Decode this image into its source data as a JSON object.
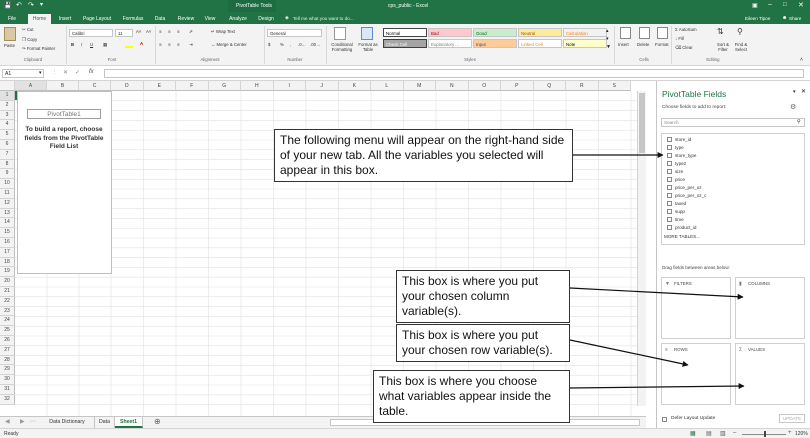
{
  "app": {
    "context_tab": "PivotTable Tools",
    "window_title": "cps_public - Excel",
    "user": "Eileen Tipoe",
    "share": "Share"
  },
  "tabs": [
    "File",
    "Home",
    "Insert",
    "Page Layout",
    "Formulas",
    "Data",
    "Review",
    "View",
    "Analyze",
    "Design"
  ],
  "active_tab": "Home",
  "tell_me": "Tell me what you want to do...",
  "ribbon": {
    "clipboard": {
      "paste": "Paste",
      "cut": "Cut",
      "copy": "Copy",
      "format_painter": "Format Painter",
      "label": "Clipboard"
    },
    "font": {
      "name": "Calibri",
      "size": "11",
      "label": "Font"
    },
    "alignment": {
      "wrap": "Wrap Text",
      "merge": "Merge & Center",
      "label": "Alignment"
    },
    "number": {
      "format": "General",
      "label": "Number"
    },
    "styles": {
      "conditional": "Conditional Formatting",
      "format_table": "Format as Table",
      "cells": [
        {
          "text": "Normal",
          "bg": "#ffffff",
          "fg": "#000000"
        },
        {
          "text": "Bad",
          "bg": "#ffc7ce",
          "fg": "#9c0006"
        },
        {
          "text": "Good",
          "bg": "#c6efce",
          "fg": "#006100"
        },
        {
          "text": "Neutral",
          "bg": "#ffeb9c",
          "fg": "#9c5700"
        },
        {
          "text": "Calculation",
          "bg": "#f2f2f2",
          "fg": "#fa7d00"
        },
        {
          "text": "Check Cell",
          "bg": "#a5a5a5",
          "fg": "#ffffff"
        },
        {
          "text": "Explanatory ...",
          "bg": "#ffffff",
          "fg": "#7f7f7f"
        },
        {
          "text": "Input",
          "bg": "#ffcc99",
          "fg": "#3f3f76"
        },
        {
          "text": "Linked Cell",
          "bg": "#ffffff",
          "fg": "#fa7d00"
        },
        {
          "text": "Note",
          "bg": "#ffffcc",
          "fg": "#000000"
        }
      ],
      "label": "Styles"
    },
    "cells": {
      "insert": "Insert",
      "delete": "Delete",
      "format": "Format",
      "label": "Cells"
    },
    "editing": {
      "autosum": "AutoSum",
      "fill": "Fill",
      "clear": "Clear",
      "sort": "Sort & Filter",
      "find": "Find & Select",
      "label": "Editing"
    }
  },
  "formula_bar": {
    "name_box": "A1",
    "fx": "fx",
    "value": ""
  },
  "grid": {
    "columns": [
      "A",
      "B",
      "C",
      "D",
      "E",
      "F",
      "G",
      "H",
      "I",
      "J",
      "K",
      "L",
      "M",
      "N",
      "O",
      "P",
      "Q",
      "R",
      "S"
    ],
    "rows": [
      "1",
      "2",
      "3",
      "4",
      "5",
      "6",
      "7",
      "8",
      "9",
      "10",
      "11",
      "12",
      "13",
      "14",
      "15",
      "16",
      "17",
      "18",
      "19",
      "20",
      "21",
      "22",
      "23",
      "24",
      "25",
      "26",
      "27",
      "28",
      "29",
      "30",
      "31",
      "32"
    ]
  },
  "pivot_placeholder": {
    "title": "PivotTable1",
    "instructions": "To build a report, choose fields from the PivotTable Field List"
  },
  "callouts": {
    "fields_menu": "The following menu will appear on the right-hand side of your new tab. All the variables you selected will appear in this box.",
    "columns": "This box is where you put your chosen column variable(s).",
    "rows": "This box is where you put your chosen row variable(s).",
    "values": "This box is where you choose what variables appear inside the table."
  },
  "sheets": {
    "tabs": [
      "Data Dictionary",
      "Data",
      "Sheet1"
    ],
    "active": "Sheet1"
  },
  "status": {
    "ready": "Ready",
    "zoom": "120%"
  },
  "pivot_pane": {
    "title": "PivotTable Fields",
    "subtitle": "Choose fields to add to report:",
    "search_placeholder": "Search",
    "fields": [
      "store_id",
      "type",
      "store_type",
      "type2",
      "size",
      "price",
      "price_per_oz",
      "price_per_oz_c",
      "taxed",
      "supp",
      "time",
      "product_id"
    ],
    "more_tables": "MORE TABLES...",
    "drag_label": "Drag fields between areas below:",
    "areas": {
      "filters": "FILTERS",
      "columns": "COLUMNS",
      "rows": "ROWS",
      "values": "VALUES"
    },
    "defer": "Defer Layout Update",
    "update": "UPDATE"
  }
}
